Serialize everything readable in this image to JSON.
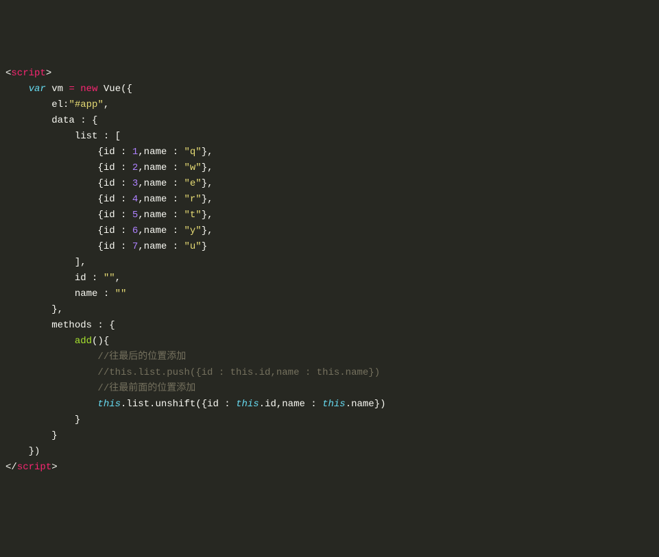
{
  "code": {
    "openTag": "script",
    "closeTag": "script",
    "var": "var",
    "vm": "vm",
    "eq": "=",
    "new": "new",
    "Vue": "Vue",
    "el": "el",
    "elValue": "\"#app\"",
    "data": "data",
    "list": "list",
    "items": [
      {
        "id": "id",
        "idVal": "1",
        "name": "name",
        "nameVal": "\"q\""
      },
      {
        "id": "id",
        "idVal": "2",
        "name": "name",
        "nameVal": "\"w\""
      },
      {
        "id": "id",
        "idVal": "3",
        "name": "name",
        "nameVal": "\"e\""
      },
      {
        "id": "id",
        "idVal": "4",
        "name": "name",
        "nameVal": "\"r\""
      },
      {
        "id": "id",
        "idVal": "5",
        "name": "name",
        "nameVal": "\"t\""
      },
      {
        "id": "id",
        "idVal": "6",
        "name": "name",
        "nameVal": "\"y\""
      },
      {
        "id": "id",
        "idVal": "7",
        "name": "name",
        "nameVal": "\"u\""
      }
    ],
    "idProp": "id",
    "idPropVal": "\"\"",
    "nameProp": "name",
    "namePropVal": "\"\"",
    "methods": "methods",
    "add": "add",
    "comment1": "//往最后的位置添加",
    "comment2": "//this.list.push({id : this.id,name : this.name})",
    "comment3": "//往最前面的位置添加",
    "this": "this",
    "listCall": ".list.unshift({id : ",
    "idCall": ".id,name : ",
    "nameCall": ".name})"
  }
}
